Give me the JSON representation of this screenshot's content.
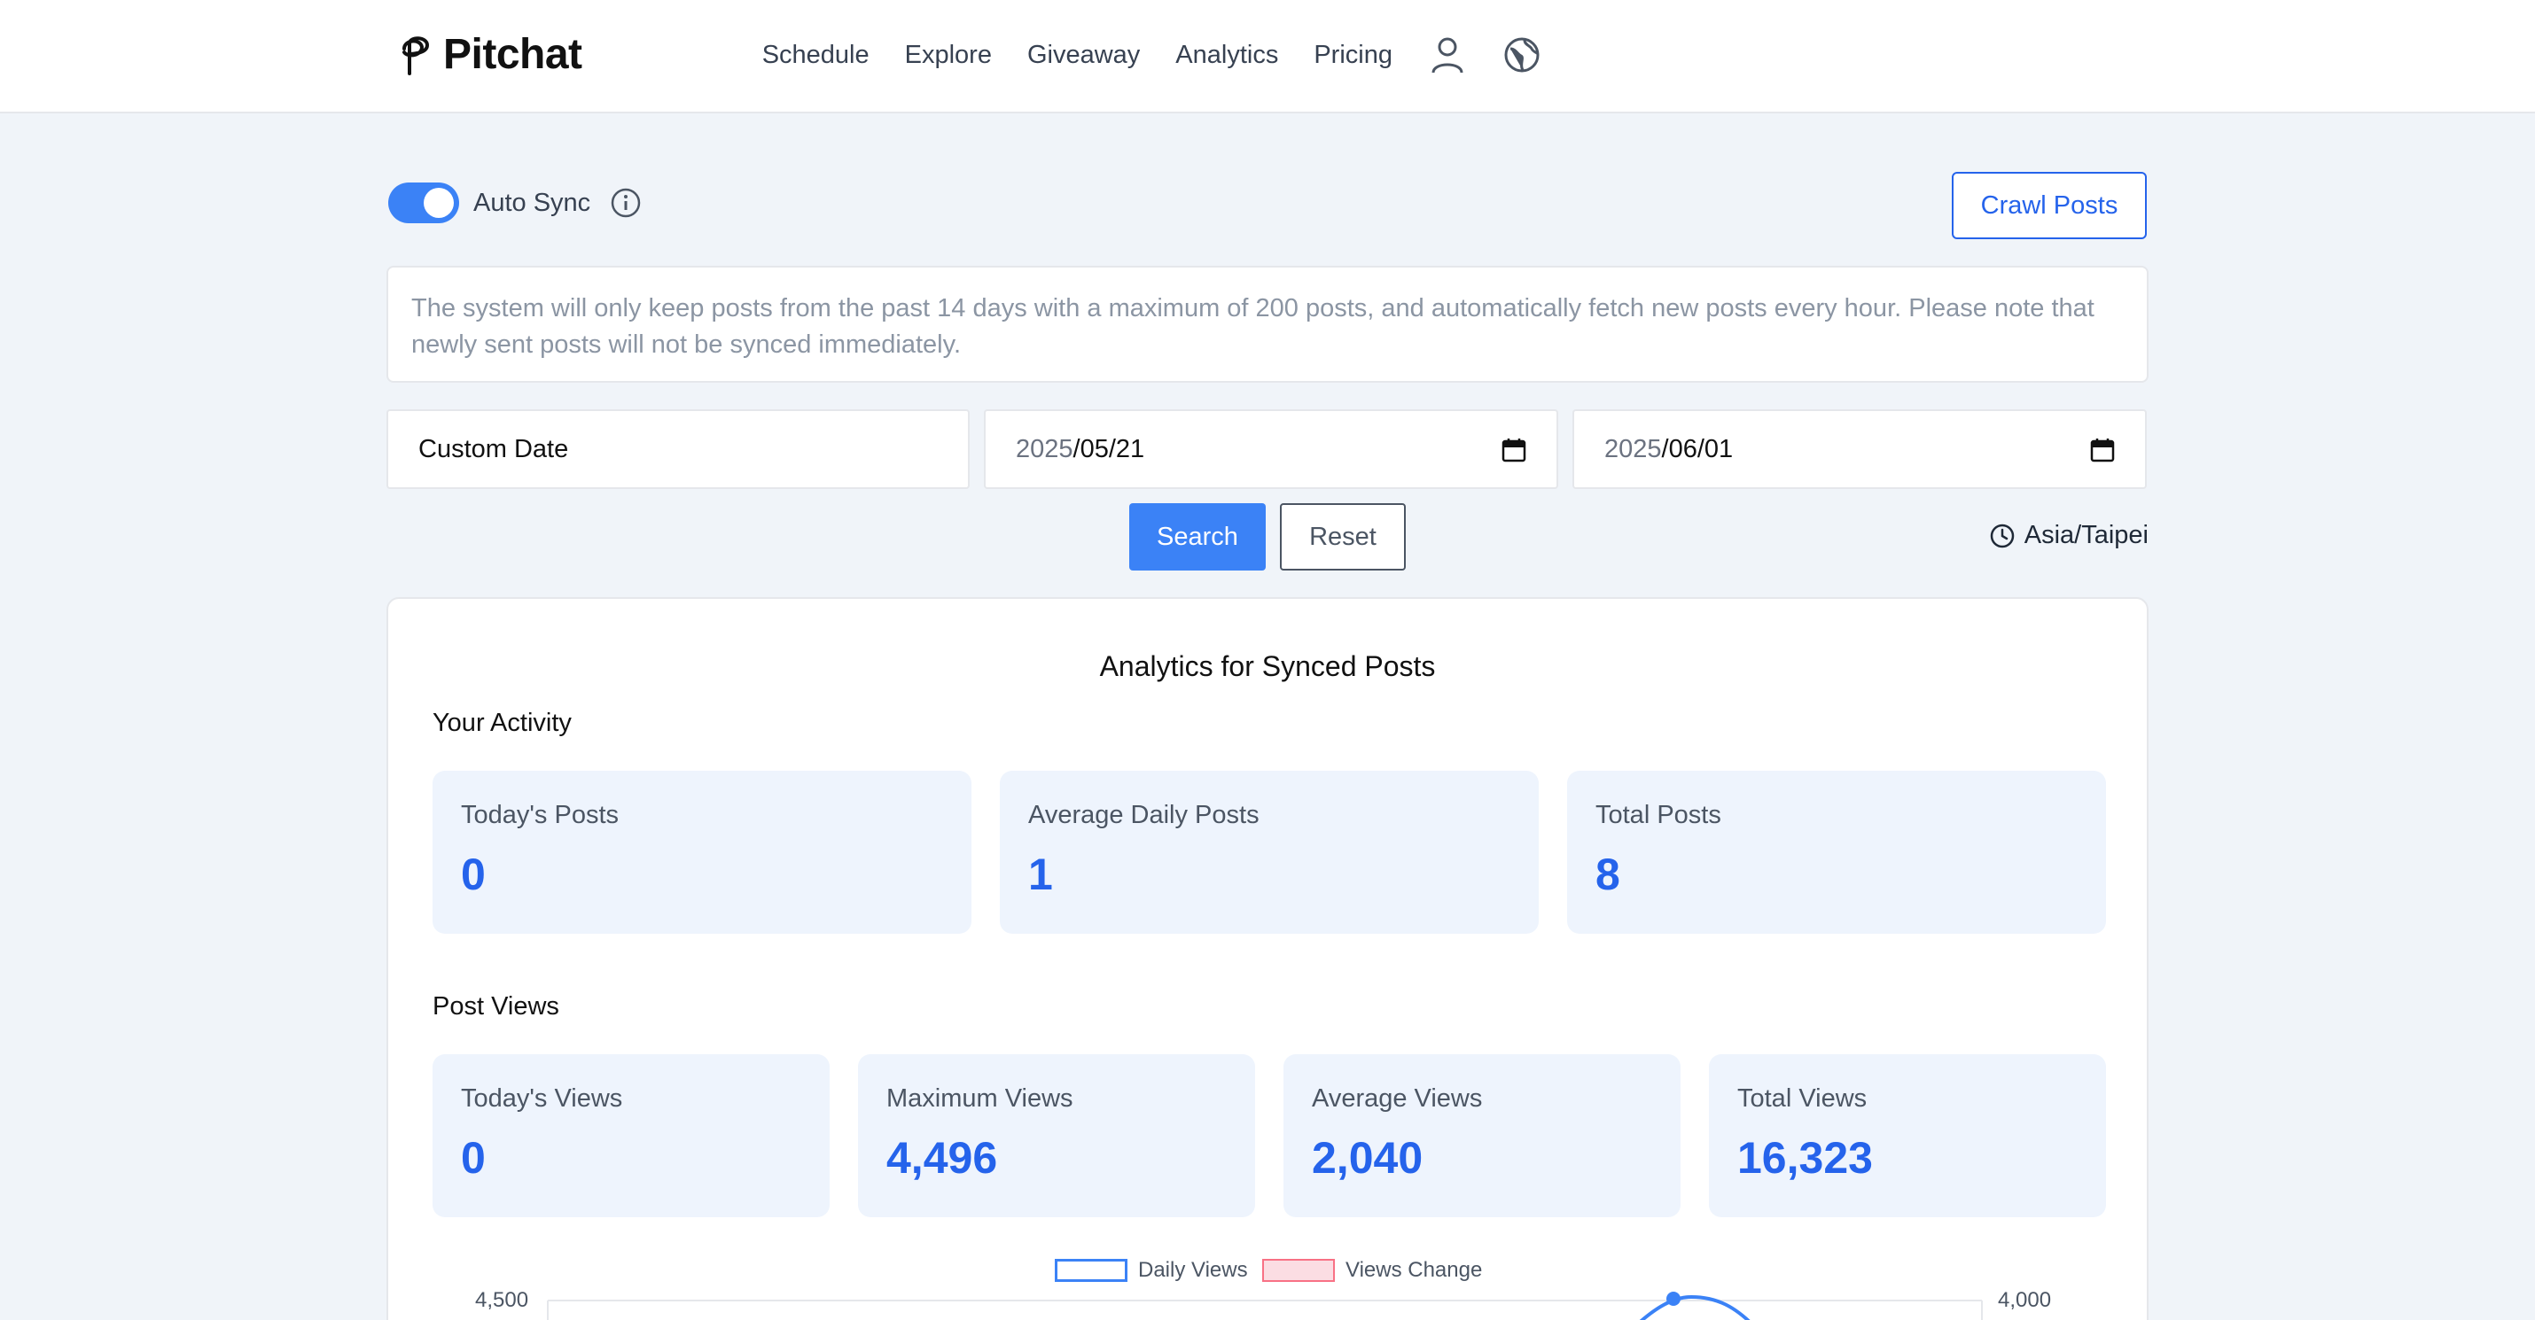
{
  "header": {
    "brand": "Pitchat",
    "nav": [
      "Schedule",
      "Explore",
      "Giveaway",
      "Analytics",
      "Pricing"
    ],
    "user_icon": "user-icon",
    "language_icon": "globe-icon"
  },
  "sync": {
    "label": "Auto Sync",
    "enabled": true,
    "crawl_label": "Crawl Posts",
    "notice": "The system will only keep posts from the past 14 days with a maximum of 200 posts, and automatically fetch new posts every hour. Please note that newly sent posts will not be synced immediately."
  },
  "filter": {
    "range_label": "Custom Date",
    "start_year": "2025",
    "start_rest": "/05/21",
    "end_year": "2025",
    "end_rest": "/06/01",
    "search_label": "Search",
    "reset_label": "Reset",
    "timezone": "Asia/Taipei"
  },
  "analytics": {
    "title": "Analytics for Synced Posts",
    "activity_title": "Your Activity",
    "activity": [
      {
        "label": "Today's Posts",
        "value": "0"
      },
      {
        "label": "Average Daily Posts",
        "value": "1"
      },
      {
        "label": "Total Posts",
        "value": "8"
      }
    ],
    "views_title": "Post Views",
    "views": [
      {
        "label": "Today's Views",
        "value": "0"
      },
      {
        "label": "Maximum Views",
        "value": "4,496"
      },
      {
        "label": "Average Views",
        "value": "2,040"
      },
      {
        "label": "Total Views",
        "value": "16,323"
      }
    ]
  },
  "chart_data": {
    "type": "line",
    "series": [
      {
        "name": "Daily Views",
        "color": "#3b82f6"
      },
      {
        "name": "Views Change",
        "color": "#f87185"
      }
    ],
    "y_left_top_tick": "4,500",
    "y_right_top_tick": "4,000"
  },
  "colors": {
    "accent": "#3b82f6",
    "stat_value": "#2563eb",
    "stat_bg": "#eef4fd",
    "page_bg": "#f0f4f9"
  }
}
